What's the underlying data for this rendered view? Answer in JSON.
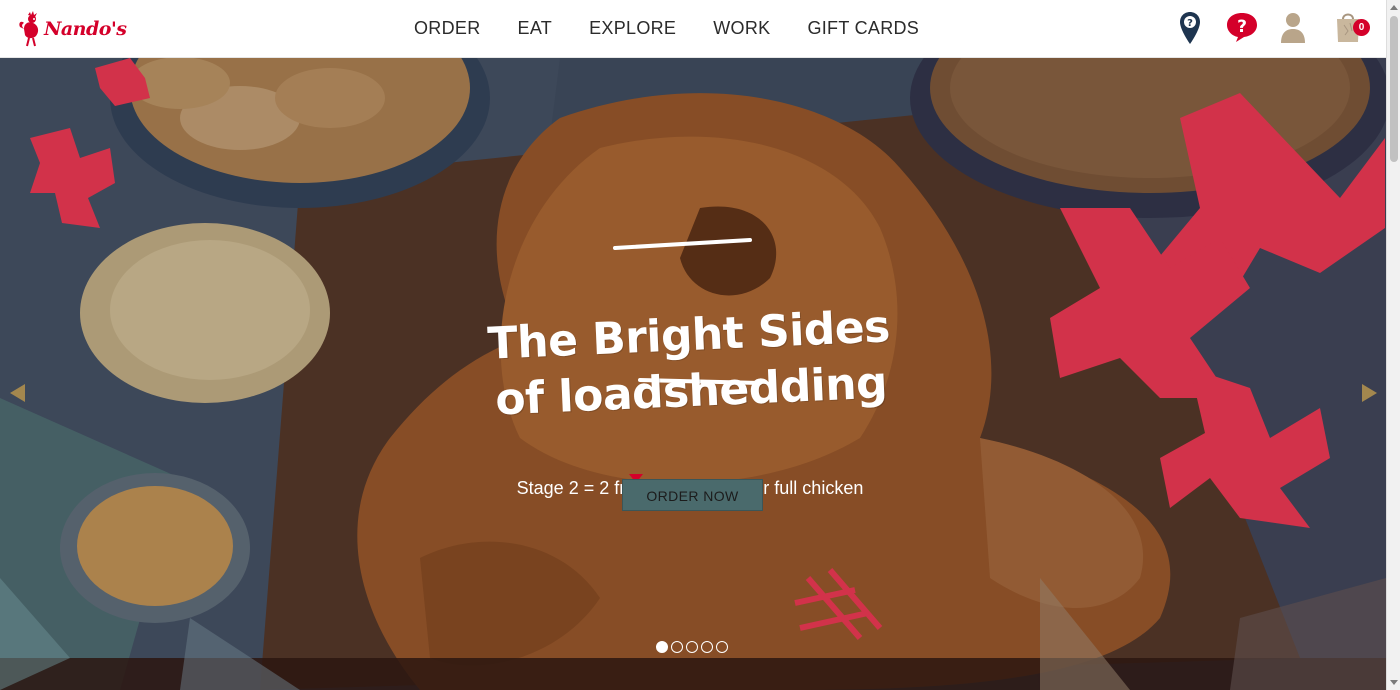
{
  "brand": {
    "name": "Nando's",
    "color": "#d4002a"
  },
  "nav": {
    "items": [
      {
        "label": "ORDER"
      },
      {
        "label": "EAT"
      },
      {
        "label": "EXPLORE"
      },
      {
        "label": "WORK"
      },
      {
        "label": "GIFT CARDS"
      }
    ]
  },
  "header_icons": {
    "location": "location-pin-icon",
    "help": "help-speech-bubble-icon",
    "account": "user-account-icon",
    "cart": "shopping-bag-icon",
    "cart_count": "0"
  },
  "hero": {
    "title_line1": "The Bright Sides",
    "title_line2": "of loadshedding",
    "subtitle": "Stage 2 = 2 free sides with your full chicken",
    "cta_label": "ORDER NOW",
    "slide_count": 5,
    "active_slide": 1
  },
  "colors": {
    "accent_red": "#d4002a",
    "cta_bg": "#4a6a6c",
    "arrow": "#a3874e"
  }
}
